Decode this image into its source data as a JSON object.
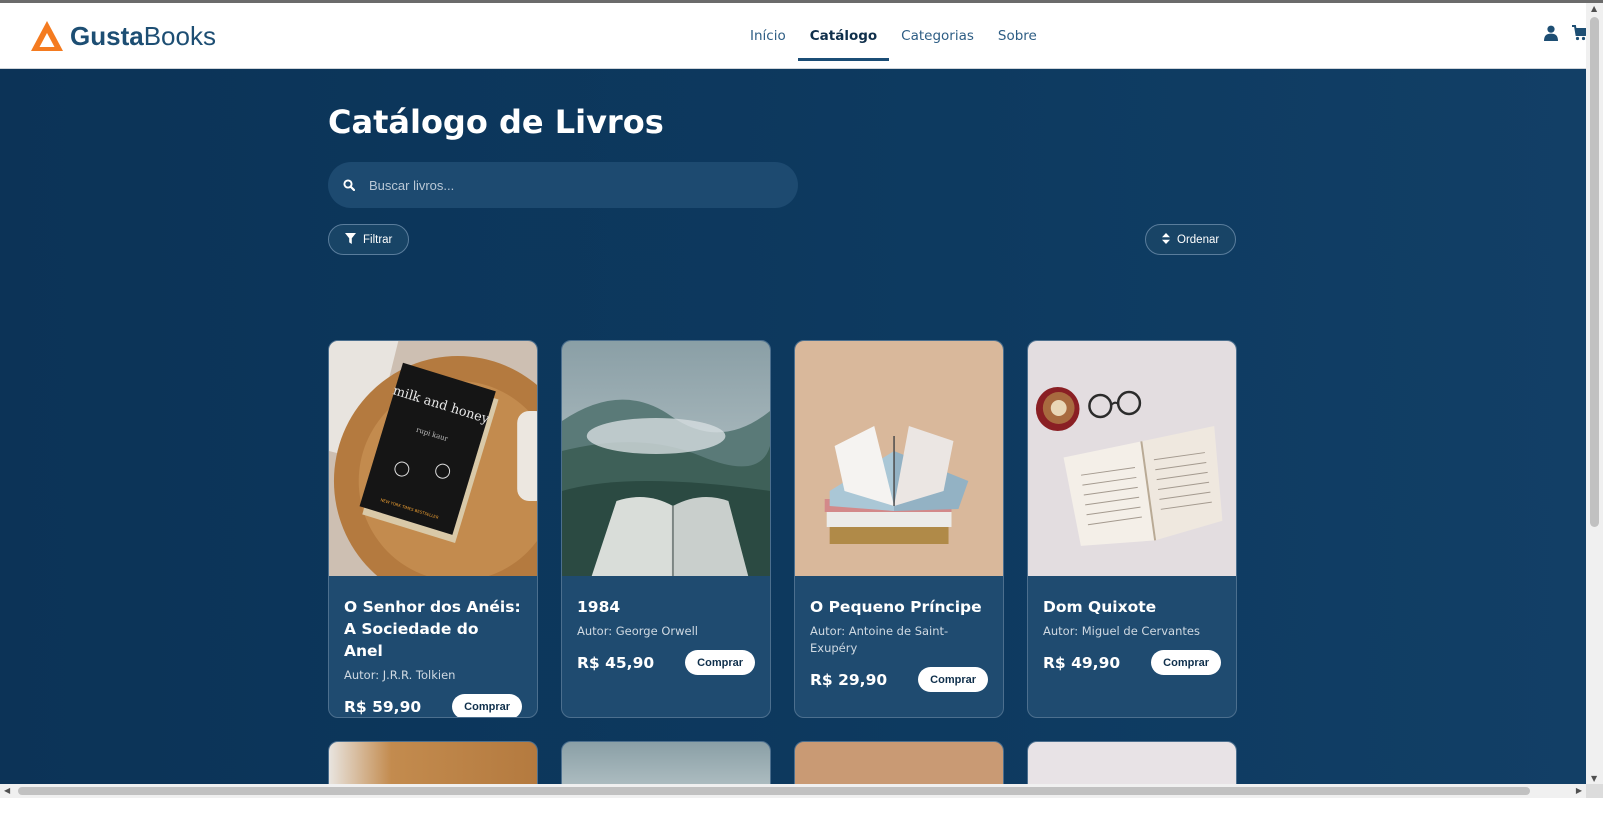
{
  "brand": {
    "name_bold": "Gusta",
    "name_regular": "Books",
    "accent_color": "#f47b20"
  },
  "nav": {
    "links": [
      {
        "label": "Início",
        "active": false
      },
      {
        "label": "Catálogo",
        "active": true
      },
      {
        "label": "Categorias",
        "active": false
      },
      {
        "label": "Sobre",
        "active": false
      }
    ],
    "icons": [
      "user-icon",
      "cart-icon"
    ]
  },
  "page": {
    "title": "Catálogo de Livros",
    "search_placeholder": "Buscar livros...",
    "filter_label": "Filtrar",
    "sort_label": "Ordenar"
  },
  "books": [
    {
      "title": "O Senhor dos Anéis: A Sociedade do Anel",
      "author": "Autor: J.R.R. Tolkien",
      "price": "R$ 59,90",
      "buy_label": "Comprar",
      "cover_text_title": "milk and honey",
      "cover_text_author": "rupi kaur",
      "cover_text_footer": "NEW YORK TIMES BESTSELLER"
    },
    {
      "title": "1984",
      "author": "Autor: George Orwell",
      "price": "R$ 45,90",
      "buy_label": "Comprar"
    },
    {
      "title": "O Pequeno Príncipe",
      "author": "Autor: Antoine de Saint-Exupéry",
      "price": "R$ 29,90",
      "buy_label": "Comprar"
    },
    {
      "title": "Dom Quixote",
      "author": "Autor: Miguel de Cervantes",
      "price": "R$ 49,90",
      "buy_label": "Comprar"
    }
  ],
  "colors": {
    "navbar_bg": "#ffffff",
    "page_bg": "#0d3a5f",
    "card_bg": "#1f4b70",
    "nav_text": "#2d5d84"
  }
}
